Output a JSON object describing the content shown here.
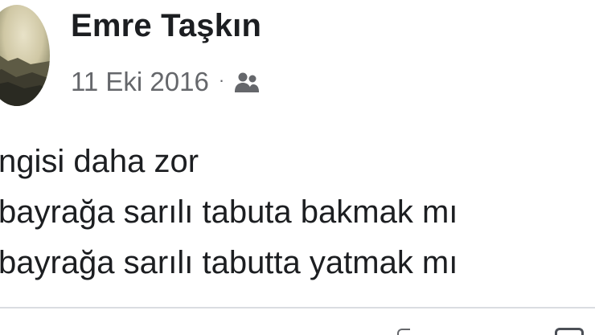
{
  "post": {
    "author_name": "Emre Taşkın",
    "date": "11 Eki 2016",
    "separator": "·",
    "privacy_icon": "friends-icon",
    "lines": [
      "ngisi daha zor",
      "bayrağa sarılı tabuta bakmak mı",
      "bayrağa sarılı tabutta yatmak mı"
    ]
  },
  "colors": {
    "text_primary": "#1c1e21",
    "text_secondary": "#65676b",
    "divider": "#dadde1"
  }
}
